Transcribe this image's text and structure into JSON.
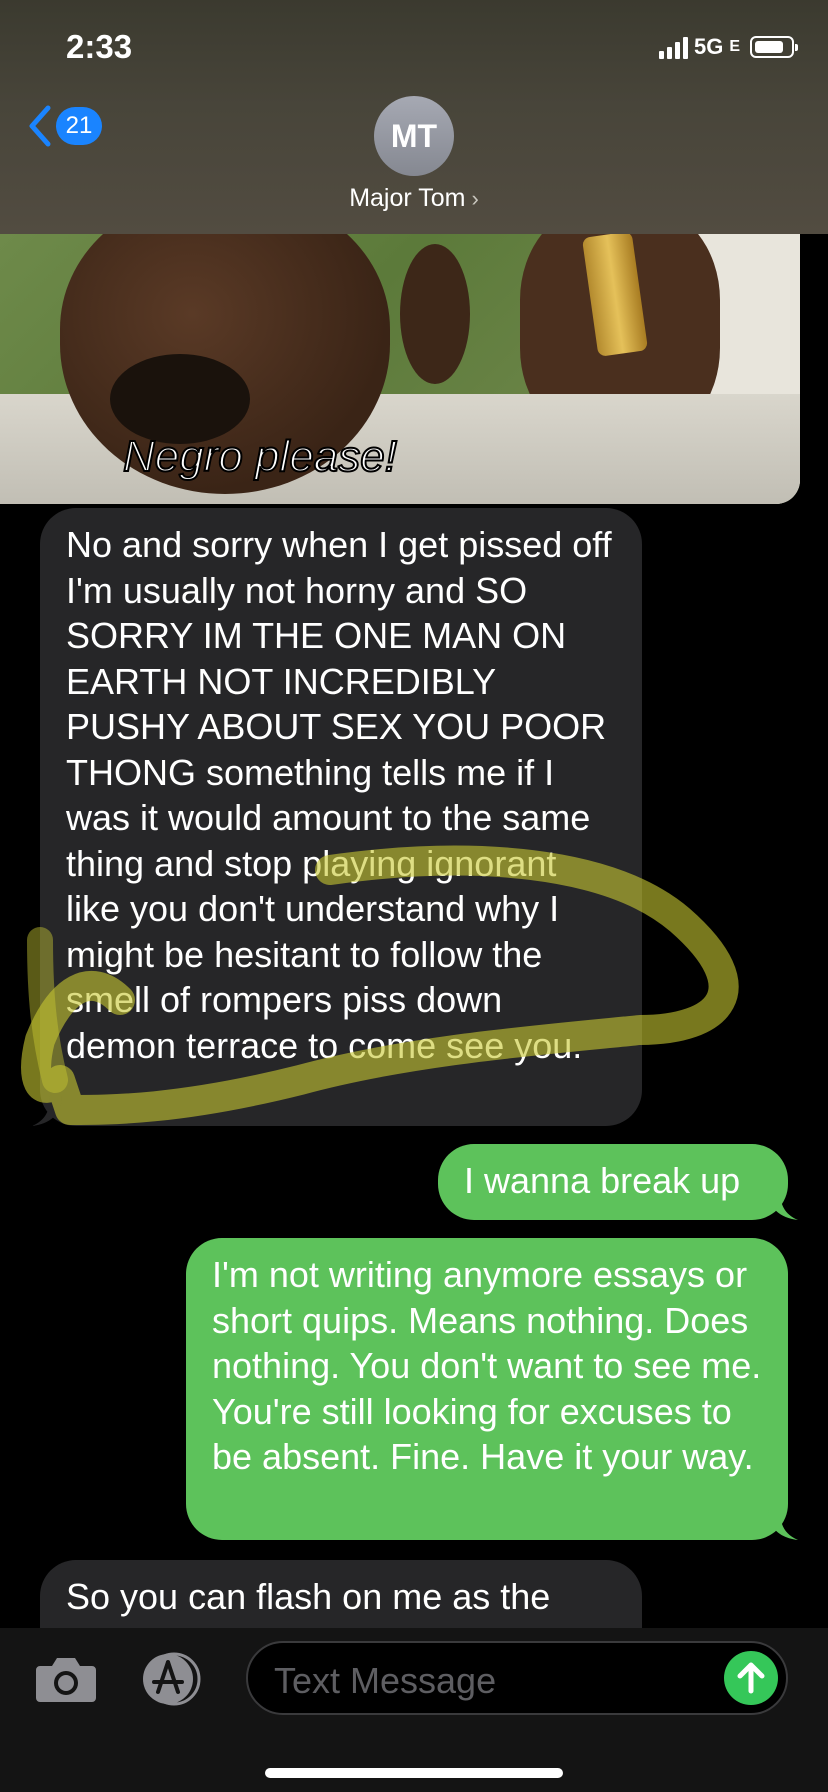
{
  "status_bar": {
    "time": "2:33",
    "network": "5G",
    "network_suffix": "E"
  },
  "header": {
    "back_count": "21",
    "avatar_initials": "MT",
    "contact_name": "Major Tom"
  },
  "attachment": {
    "caption": "Negro please!"
  },
  "messages": [
    {
      "direction": "incoming",
      "text": "No and sorry when I get pissed off I'm usually not horny and SO SORRY IM THE ONE MAN ON EARTH NOT INCREDIBLY PUSHY ABOUT SEX YOU POOR THONG something tells me if I was it would amount to the same thing and stop playing ignorant like you don't understand why I might be hesitant to follow the smell of rompers piss down demon terrace to come see you."
    },
    {
      "direction": "outgoing",
      "text": "I wanna break up"
    },
    {
      "direction": "outgoing",
      "text": "I'm not writing anymore essays or short quips. Means nothing. Does nothing. You don't want to see me. You're still looking for excuses to be absent. Fine. Have it your way."
    },
    {
      "direction": "incoming",
      "text": "So you can flash on me as the"
    }
  ],
  "composer": {
    "placeholder": "Text Message"
  },
  "colors": {
    "incoming_bubble": "#262628",
    "outgoing_bubble": "#5dc25b",
    "accent": "#1a84ff",
    "highlighter": "#c8c832"
  }
}
